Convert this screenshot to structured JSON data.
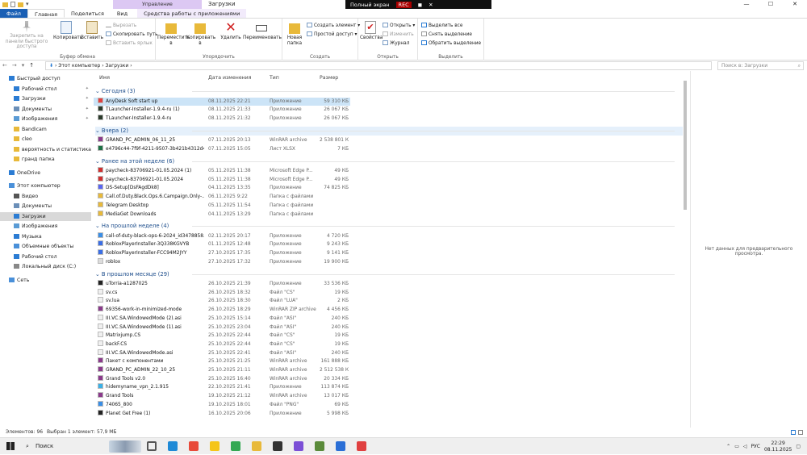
{
  "titlebar": {
    "context_tab": "Управление",
    "window_title": "Загрузки",
    "controls": [
      "—",
      "☐",
      "✕"
    ],
    "recorder": {
      "fullscreen": "Полный экран",
      "rec": "REC"
    }
  },
  "tabs": [
    {
      "label": "Файл"
    },
    {
      "label": "Главная"
    },
    {
      "label": "Поделиться"
    },
    {
      "label": "Вид"
    },
    {
      "label": "Средства работы с приложениями"
    }
  ],
  "ribbon": {
    "clipboard": {
      "pin": "Закрепить на панели быстрого доступа",
      "copy": "Копировать",
      "paste": "Вставить",
      "cut": "Вырезать",
      "copy_path": "Скопировать путь",
      "paste_shortcut": "Вставить ярлык",
      "group": "Буфер обмена"
    },
    "organize": {
      "move": "Переместить в",
      "copy_to": "Копировать в",
      "delete": "Удалить",
      "rename": "Переименовать",
      "group": "Упорядочить"
    },
    "create": {
      "new_folder": "Новая папка",
      "new_item": "Создать элемент",
      "easy_access": "Простой доступ",
      "group": "Создать"
    },
    "open": {
      "properties": "Свойства",
      "open": "Открыть",
      "edit": "Изменить",
      "history": "Журнал",
      "group": "Открыть"
    },
    "select": {
      "select_all": "Выделить все",
      "select_none": "Снять выделение",
      "invert": "Обратить выделение",
      "group": "Выделить"
    }
  },
  "address": {
    "path": "›  Этот компьютер  ›  Загрузки  ›",
    "search_placeholder": "Поиск в: Загрузки"
  },
  "nav": [
    {
      "label": "Быстрый доступ",
      "color": "#2b7cd3",
      "pinned": false,
      "indent": 0
    },
    {
      "label": "Рабочий стол",
      "color": "#2b7cd3",
      "pinned": true,
      "indent": 1
    },
    {
      "label": "Загрузки",
      "color": "#2b7cd3",
      "pinned": true,
      "indent": 1
    },
    {
      "label": "Документы",
      "color": "#6b8fb8",
      "pinned": true,
      "indent": 1
    },
    {
      "label": "Изображения",
      "color": "#5a9bd5",
      "pinned": true,
      "indent": 1
    },
    {
      "label": "Bandicam",
      "color": "#e8b93a",
      "pinned": false,
      "indent": 1
    },
    {
      "label": "cleo",
      "color": "#e8b93a",
      "pinned": false,
      "indent": 1
    },
    {
      "label": "вероятность и статистика",
      "color": "#e8b93a",
      "pinned": false,
      "indent": 1
    },
    {
      "label": "гранд папка",
      "color": "#e8b93a",
      "pinned": false,
      "indent": 1
    },
    {
      "label": "OneDrive",
      "color": "#2b7cd3",
      "pinned": false,
      "indent": 0
    },
    {
      "label": "Этот компьютер",
      "color": "#4a90d9",
      "pinned": false,
      "indent": 0
    },
    {
      "label": "Видео",
      "color": "#555555",
      "pinned": false,
      "indent": 1
    },
    {
      "label": "Документы",
      "color": "#6b8fb8",
      "pinned": false,
      "indent": 1
    },
    {
      "label": "Загрузки",
      "color": "#2b7cd3",
      "pinned": false,
      "indent": 1,
      "selected": true
    },
    {
      "label": "Изображения",
      "color": "#5a9bd5",
      "pinned": false,
      "indent": 1
    },
    {
      "label": "Музыка",
      "color": "#2b7cd3",
      "pinned": false,
      "indent": 1
    },
    {
      "label": "Объемные объекты",
      "color": "#4a90d9",
      "pinned": false,
      "indent": 1
    },
    {
      "label": "Рабочий стол",
      "color": "#2b7cd3",
      "pinned": false,
      "indent": 1
    },
    {
      "label": "Локальный диск (C:)",
      "color": "#888888",
      "pinned": false,
      "indent": 1
    },
    {
      "label": "Сеть",
      "color": "#4a90d9",
      "pinned": false,
      "indent": 0
    }
  ],
  "columns": {
    "name": "Имя",
    "date": "Дата изменения",
    "type": "Тип",
    "size": "Размер"
  },
  "groups": [
    {
      "title": "Сегодня (3)",
      "items": [
        {
          "name": "AnyDesk Soft start up",
          "date": "08.11.2025 22:21",
          "type": "Приложение",
          "size": "59 310 КБ",
          "icon": "#e04040",
          "selected": true
        },
        {
          "name": "TLauncher-Installer-1.9.4-ru (1)",
          "date": "08.11.2025 21:33",
          "type": "Приложение",
          "size": "26 067 КБ",
          "icon": "#2a3a2a"
        },
        {
          "name": "TLauncher-Installer-1.9.4-ru",
          "date": "08.11.2025 21:32",
          "type": "Приложение",
          "size": "26 067 КБ",
          "icon": "#2a3a2a"
        }
      ]
    },
    {
      "title": "Вчера (2)",
      "highlight": true,
      "items": [
        {
          "name": "GRAND_PC_ADMIN_06_11_25",
          "date": "07.11.2025 20:13",
          "type": "WinRAR archive",
          "size": "2 538 801 КБ",
          "icon": "#8b3a8b"
        },
        {
          "name": "e4796c44-7f9f-4211-9507-3b421b4312d4",
          "date": "07.11.2025 15:05",
          "type": "Лист XLSX",
          "size": "7 КБ",
          "icon": "#1e7145"
        }
      ]
    },
    {
      "title": "Ранее на этой неделе (6)",
      "items": [
        {
          "name": "paycheck-83706921-01.05.2024 (1)",
          "date": "05.11.2025 11:38",
          "type": "Microsoft Edge P...",
          "size": "49 КБ",
          "icon": "#d03030"
        },
        {
          "name": "paycheck-83706921-01.05.2024",
          "date": "05.11.2025 11:38",
          "type": "Microsoft Edge P...",
          "size": "49 КБ",
          "icon": "#d03030"
        },
        {
          "name": "DS-Setup[DsFAgdDk8]",
          "date": "04.11.2025 13:35",
          "type": "Приложение",
          "size": "74 825 КБ",
          "icon": "#5865f2"
        },
        {
          "name": "Call.of.Duty.Black.Ops.6.Campaign.Only-...",
          "date": "06.11.2025 9:22",
          "type": "Папка с файлами",
          "size": "",
          "icon": "#e8b93a"
        },
        {
          "name": "Telegram Desktop",
          "date": "05.11.2025 11:54",
          "type": "Папка с файлами",
          "size": "",
          "icon": "#e8b93a"
        },
        {
          "name": "MediaGet Downloads",
          "date": "04.11.2025 13:29",
          "type": "Папка с файлами",
          "size": "",
          "icon": "#e8b93a"
        }
      ]
    },
    {
      "title": "На прошлой неделе (4)",
      "items": [
        {
          "name": "call-of-duty-black-ops-6-2024_id3478858...",
          "date": "02.11.2025 20:17",
          "type": "Приложение",
          "size": "4 720 КБ",
          "icon": "#3a8ee6"
        },
        {
          "name": "RobloxPlayerInstaller-3Q338KGVYB",
          "date": "01.11.2025 12:48",
          "type": "Приложение",
          "size": "9 243 КБ",
          "icon": "#3a6ee6"
        },
        {
          "name": "RobloxPlayerInstaller-FCC94M2JYY",
          "date": "27.10.2025 17:35",
          "type": "Приложение",
          "size": "9 141 КБ",
          "icon": "#3a6ee6"
        },
        {
          "name": "roblox",
          "date": "27.10.2025 17:32",
          "type": "Приложение",
          "size": "19 900 КБ",
          "icon": "#dcdcdc"
        }
      ]
    },
    {
      "title": "В прошлом месяце (29)",
      "items": [
        {
          "name": "uTorria-a1287025",
          "date": "26.10.2025 21:39",
          "type": "Приложение",
          "size": "33 536 КБ",
          "icon": "#222222"
        },
        {
          "name": "sv.cs",
          "date": "26.10.2025 18:32",
          "type": "Файл \"CS\"",
          "size": "19 КБ",
          "icon": "#f0f0f0"
        },
        {
          "name": "sv.lua",
          "date": "26.10.2025 18:30",
          "type": "Файл \"LUA\"",
          "size": "2 КБ",
          "icon": "#f0f0f0"
        },
        {
          "name": "69356-work-in-minimized-mode",
          "date": "26.10.2025 18:29",
          "type": "WinRAR ZIP archive",
          "size": "4 456 КБ",
          "icon": "#8b3a8b"
        },
        {
          "name": "III.VC.SA.WindowedMode (2).asi",
          "date": "25.10.2025 15:14",
          "type": "Файл \"ASI\"",
          "size": "240 КБ",
          "icon": "#f0f0f0"
        },
        {
          "name": "III.VC.SA.WindowedMode (1).asi",
          "date": "25.10.2025 23:04",
          "type": "Файл \"ASI\"",
          "size": "240 КБ",
          "icon": "#f0f0f0"
        },
        {
          "name": "Matrixjump.CS",
          "date": "25.10.2025 22:44",
          "type": "Файл \"CS\"",
          "size": "19 КБ",
          "icon": "#f0f0f0"
        },
        {
          "name": "backF.CS",
          "date": "25.10.2025 22:44",
          "type": "Файл \"CS\"",
          "size": "19 КБ",
          "icon": "#f0f0f0"
        },
        {
          "name": "III.VC.SA.WindowedMode.asi",
          "date": "25.10.2025 22:41",
          "type": "Файл \"ASI\"",
          "size": "240 КБ",
          "icon": "#f0f0f0"
        },
        {
          "name": "Пакет с компонентами",
          "date": "25.10.2025 21:25",
          "type": "WinRAR archive",
          "size": "161 888 КБ",
          "icon": "#8b3a8b"
        },
        {
          "name": "GRAND_PC_ADMIN_22_10_25",
          "date": "25.10.2025 21:11",
          "type": "WinRAR archive",
          "size": "2 512 538 КБ",
          "icon": "#8b3a8b"
        },
        {
          "name": "Grand Tools v2.0",
          "date": "25.10.2025 16:40",
          "type": "WinRAR archive",
          "size": "20 334 КБ",
          "icon": "#8b3a8b"
        },
        {
          "name": "hidemyname_vpn_2.1.915",
          "date": "22.10.2025 21:41",
          "type": "Приложение",
          "size": "113 874 КБ",
          "icon": "#3ab0e6"
        },
        {
          "name": "Grand Tools",
          "date": "19.10.2025 21:12",
          "type": "WinRAR archive",
          "size": "13 017 КБ",
          "icon": "#8b3a8b"
        },
        {
          "name": "74065_800",
          "date": "19.10.2025 18:01",
          "type": "Файл \"PNG\"",
          "size": "69 КБ",
          "icon": "#3a8ee6"
        },
        {
          "name": "Planet Get Free (1)",
          "date": "16.10.2025 20:06",
          "type": "Приложение",
          "size": "5 998 КБ",
          "icon": "#222222"
        }
      ]
    }
  ],
  "preview": {
    "empty_text": "Нет данных для предварительного просмотра."
  },
  "status": {
    "count": "Элементов: 96",
    "selection": "Выбран 1 элемент: 57,9 МБ"
  },
  "taskbar": {
    "search_label": "Поиск",
    "icons": [
      {
        "name": "task-view-icon",
        "color": "#555555"
      },
      {
        "name": "edge-icon",
        "color": "#1f8ad6"
      },
      {
        "name": "yandex-icon",
        "color": "#e84a3a"
      },
      {
        "name": "yandex-browser-icon",
        "color": "#f5c518"
      },
      {
        "name": "chrome-icon",
        "color": "#34a853"
      },
      {
        "name": "explorer-icon",
        "color": "#e8b93a"
      },
      {
        "name": "security-icon",
        "color": "#333333"
      },
      {
        "name": "discord-icon",
        "color": "#7b4fd6"
      },
      {
        "name": "minecraft-icon",
        "color": "#5a8a3a"
      },
      {
        "name": "store-icon",
        "color": "#2b6fd6"
      },
      {
        "name": "bandicam-icon",
        "color": "#e04040"
      }
    ],
    "tray": {
      "lang": "РУС",
      "time": "22:29",
      "date": "08.11.2025"
    }
  }
}
